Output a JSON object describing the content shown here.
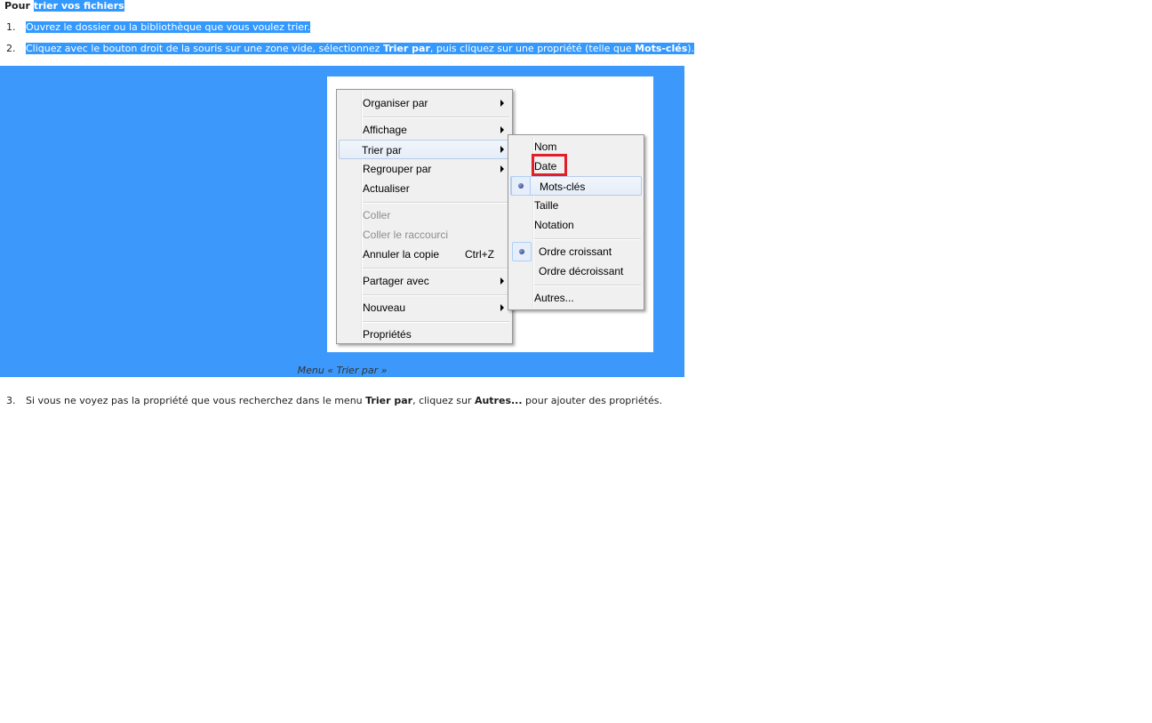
{
  "heading": {
    "prefix": "Pour",
    "link": "trier vos fichiers"
  },
  "steps": [
    {
      "num": "1.",
      "text": "Ouvrez le dossier ou la bibliothèque que vous voulez trier."
    },
    {
      "num": "2.",
      "t1": "Cliquez avec le bouton droit de la souris sur une zone vide, sélectionnez ",
      "b1": "Trier par",
      "t2": ", puis cliquez sur une propriété (telle que ",
      "b2": "Mots-clés",
      "t3": ")."
    },
    {
      "num": "3.",
      "t1": "Si vous ne voyez pas la propriété que vous recherchez dans le menu ",
      "b1": "Trier par",
      "t2": ", cliquez sur ",
      "b2": "Autres...",
      "t3": " pour ajouter des propriétés."
    }
  ],
  "figure": {
    "caption": "Menu « Trier par »",
    "band_color": "#3c99fb",
    "main_menu": [
      {
        "label": "Organiser par",
        "submenu": true
      },
      {
        "label": "Affichage",
        "submenu": true
      },
      {
        "label": "Trier par",
        "submenu": true,
        "highlighted": true
      },
      {
        "label": "Regrouper par",
        "submenu": true
      },
      {
        "label": "Actualiser"
      },
      {
        "label": "Coller",
        "disabled": true
      },
      {
        "label": "Coller le raccourci",
        "disabled": true
      },
      {
        "label": "Annuler la copie",
        "shortcut": "Ctrl+Z"
      },
      {
        "label": "Partager avec",
        "submenu": true
      },
      {
        "label": "Nouveau",
        "submenu": true
      },
      {
        "label": "Propriétés"
      }
    ],
    "sort_submenu": [
      {
        "label": "Nom"
      },
      {
        "label": "Date",
        "boxed": true
      },
      {
        "label": "Mots-clés",
        "checked": true,
        "highlighted": true
      },
      {
        "label": "Taille"
      },
      {
        "label": "Notation"
      },
      {
        "label": "Ordre croissant",
        "checked": true
      },
      {
        "label": "Ordre décroissant"
      },
      {
        "label": "Autres..."
      }
    ]
  }
}
